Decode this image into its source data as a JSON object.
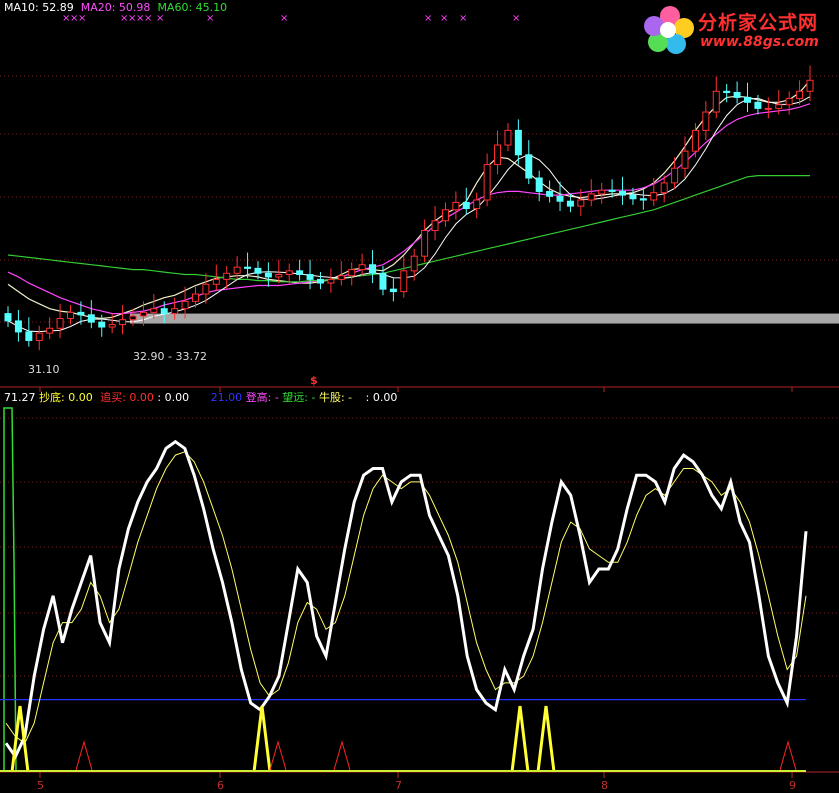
{
  "top_legend": {
    "ma10": "MA10: 52.89",
    "ma20": "MA20: 50.98",
    "ma60": "MA60: 45.10",
    "colors": {
      "ma10": "#ffffff",
      "ma20": "#ff4dff",
      "ma60": "#33dd33"
    }
  },
  "bottom_legend": {
    "value": "71.27",
    "chaodi": "抄底: 0.00",
    "zhuimai": "追买:",
    "zhuimai_val": "0.00",
    "sep_val": ": 0.00",
    "blue_val": "21.00",
    "denggao": "登高: -",
    "wangyuan": "望远: -",
    "niugu": "牛股: -",
    "last_val": ": 0.00"
  },
  "logo": {
    "title": "分析家公式网",
    "url": "www.88gs.com",
    "icon": "flower-logo-icon"
  },
  "annotations": {
    "low_price": "31.10",
    "range": "32.90 - 33.72",
    "marker": "$"
  },
  "x_ticks": [
    "5",
    "6",
    "7",
    "8",
    "9"
  ],
  "chart_data": [
    {
      "type": "candlestick",
      "panel": "price",
      "ma_periods": [
        10,
        20,
        60
      ],
      "ma_values_last": {
        "MA10": 52.89,
        "MA20": 50.98,
        "MA60": 45.1
      },
      "price_annotations": {
        "low": 31.1,
        "band_low": 32.9,
        "band_high": 33.72
      },
      "ylim": [
        30,
        58
      ],
      "grid": true,
      "series": [
        {
          "name": "close",
          "values": [
            33.2,
            32.3,
            31.6,
            32.2,
            32.6,
            33.4,
            33.9,
            33.7,
            33.1,
            32.7,
            32.9,
            33.3,
            33.6,
            33.9,
            34.2,
            33.8,
            34.2,
            34.8,
            35.4,
            36.2,
            36.6,
            37.1,
            37.6,
            37.5,
            37.1,
            36.8,
            37.0,
            37.3,
            37.0,
            36.6,
            36.3,
            36.6,
            36.9,
            37.4,
            37.8,
            37.1,
            35.8,
            35.6,
            37.3,
            38.5,
            40.6,
            41.4,
            42.3,
            42.9,
            42.4,
            43.1,
            46.0,
            47.6,
            48.8,
            46.8,
            44.9,
            43.8,
            43.4,
            43.0,
            42.6,
            43.1,
            43.6,
            43.9,
            43.8,
            43.5,
            43.2,
            43.1,
            43.7,
            44.5,
            45.7,
            47.1,
            48.8,
            50.3,
            52.0,
            51.9,
            51.5,
            51.1,
            50.6,
            50.6,
            50.9,
            51.4,
            52.0,
            52.9
          ]
        },
        {
          "name": "MA10",
          "values": [
            36.2,
            35.6,
            35.0,
            34.6,
            34.2,
            34.0,
            33.9,
            33.7,
            33.5,
            33.4,
            33.5,
            33.8,
            34.1,
            34.5,
            34.8,
            35.1,
            35.3,
            35.7,
            36.1,
            36.4,
            36.7,
            36.8,
            36.9,
            36.9,
            36.8,
            36.6,
            36.5,
            36.4,
            36.3,
            36.3,
            36.4,
            36.6,
            37.0,
            37.4,
            37.5,
            37.4,
            37.3,
            37.8,
            38.6,
            39.6,
            40.6,
            41.4,
            42.0,
            42.4,
            43.0,
            44.5,
            45.8,
            46.6,
            46.5,
            45.9,
            45.3,
            44.6,
            44.0,
            43.6,
            43.4,
            43.3,
            43.4,
            43.5,
            43.6,
            43.6,
            43.7,
            44.0,
            44.5,
            45.3,
            46.3,
            47.5,
            48.8,
            49.9,
            50.8,
            51.5,
            51.6,
            51.5,
            51.3,
            51.1,
            51.1,
            51.3,
            51.9,
            52.89
          ]
        },
        {
          "name": "MA20",
          "values": [
            37.2,
            36.8,
            36.3,
            35.9,
            35.5,
            35.1,
            34.8,
            34.5,
            34.2,
            34.0,
            33.8,
            33.8,
            33.9,
            34.0,
            34.2,
            34.5,
            34.7,
            34.9,
            35.2,
            35.5,
            35.7,
            35.8,
            35.9,
            36.0,
            36.1,
            36.1,
            36.1,
            36.2,
            36.3,
            36.4,
            36.5,
            36.6,
            36.8,
            37.1,
            37.4,
            37.6,
            37.8,
            38.3,
            38.9,
            39.6,
            40.3,
            41.0,
            41.6,
            42.1,
            42.6,
            43.1,
            43.5,
            43.7,
            43.8,
            43.8,
            43.7,
            43.6,
            43.5,
            43.5,
            43.6,
            43.7,
            43.8,
            43.9,
            43.9,
            43.9,
            43.9,
            44.1,
            44.4,
            44.9,
            45.5,
            46.2,
            47.0,
            47.8,
            48.5,
            49.2,
            49.7,
            50.0,
            50.2,
            50.3,
            50.4,
            50.5,
            50.7,
            50.98
          ]
        },
        {
          "name": "MA60",
          "values": [
            38.6,
            38.5,
            38.4,
            38.3,
            38.2,
            38.1,
            38.0,
            37.9,
            37.8,
            37.7,
            37.6,
            37.5,
            37.4,
            37.4,
            37.3,
            37.2,
            37.1,
            37.0,
            37.0,
            36.9,
            36.8,
            36.7,
            36.6,
            36.6,
            36.5,
            36.5,
            36.4,
            36.4,
            36.4,
            36.5,
            36.5,
            36.6,
            36.7,
            36.8,
            36.9,
            37.0,
            37.1,
            37.3,
            37.5,
            37.7,
            37.9,
            38.1,
            38.3,
            38.5,
            38.7,
            38.9,
            39.1,
            39.3,
            39.5,
            39.7,
            39.9,
            40.1,
            40.3,
            40.5,
            40.7,
            40.9,
            41.1,
            41.3,
            41.5,
            41.7,
            41.9,
            42.1,
            42.3,
            42.6,
            42.9,
            43.2,
            43.5,
            43.8,
            44.1,
            44.4,
            44.7,
            45.0,
            45.1,
            45.1,
            45.1,
            45.1,
            45.1,
            45.1
          ]
        }
      ]
    },
    {
      "type": "line",
      "panel": "indicator",
      "ylim": [
        0,
        100
      ],
      "reference_line": 21.0,
      "last_value": 71.27,
      "grid": true,
      "series": [
        {
          "name": "K",
          "color": "#ffffff",
          "values": [
            8,
            4,
            10,
            28,
            42,
            52,
            38,
            48,
            56,
            64,
            44,
            38,
            60,
            72,
            80,
            86,
            90,
            96,
            98,
            96,
            88,
            78,
            66,
            56,
            44,
            30,
            20,
            18,
            22,
            28,
            44,
            60,
            56,
            40,
            34,
            50,
            66,
            80,
            88,
            90,
            90,
            80,
            86,
            88,
            88,
            76,
            70,
            64,
            52,
            34,
            24,
            20,
            18,
            30,
            24,
            34,
            42,
            60,
            74,
            86,
            82,
            70,
            56,
            60,
            60,
            66,
            78,
            88,
            88,
            86,
            80,
            90,
            94,
            92,
            88,
            82,
            78,
            86,
            74,
            68,
            52,
            34,
            26,
            20,
            40,
            71.27
          ]
        },
        {
          "name": "D",
          "color": "#ffff66",
          "values": [
            14,
            10,
            8,
            14,
            26,
            38,
            44,
            44,
            48,
            56,
            52,
            44,
            48,
            58,
            68,
            76,
            84,
            90,
            94,
            95,
            92,
            86,
            78,
            70,
            60,
            48,
            36,
            26,
            22,
            24,
            32,
            44,
            50,
            48,
            42,
            44,
            52,
            64,
            76,
            84,
            88,
            86,
            84,
            86,
            86,
            82,
            76,
            70,
            62,
            50,
            38,
            30,
            24,
            26,
            26,
            28,
            34,
            44,
            56,
            68,
            74,
            72,
            66,
            64,
            62,
            62,
            68,
            76,
            82,
            84,
            82,
            86,
            90,
            90,
            88,
            86,
            82,
            84,
            80,
            74,
            64,
            52,
            40,
            30,
            34,
            52
          ]
        }
      ],
      "signal_spikes": [
        {
          "index": 1,
          "color": "#ffff33",
          "height": 13
        },
        {
          "index": 25,
          "color": "#ffff33",
          "height": 13
        },
        {
          "index": 52,
          "color": "#ffff33",
          "height": 13
        },
        {
          "index": 54,
          "color": "#ffff33",
          "height": 13
        }
      ],
      "red_markers": [
        7,
        27,
        33,
        79
      ]
    }
  ]
}
